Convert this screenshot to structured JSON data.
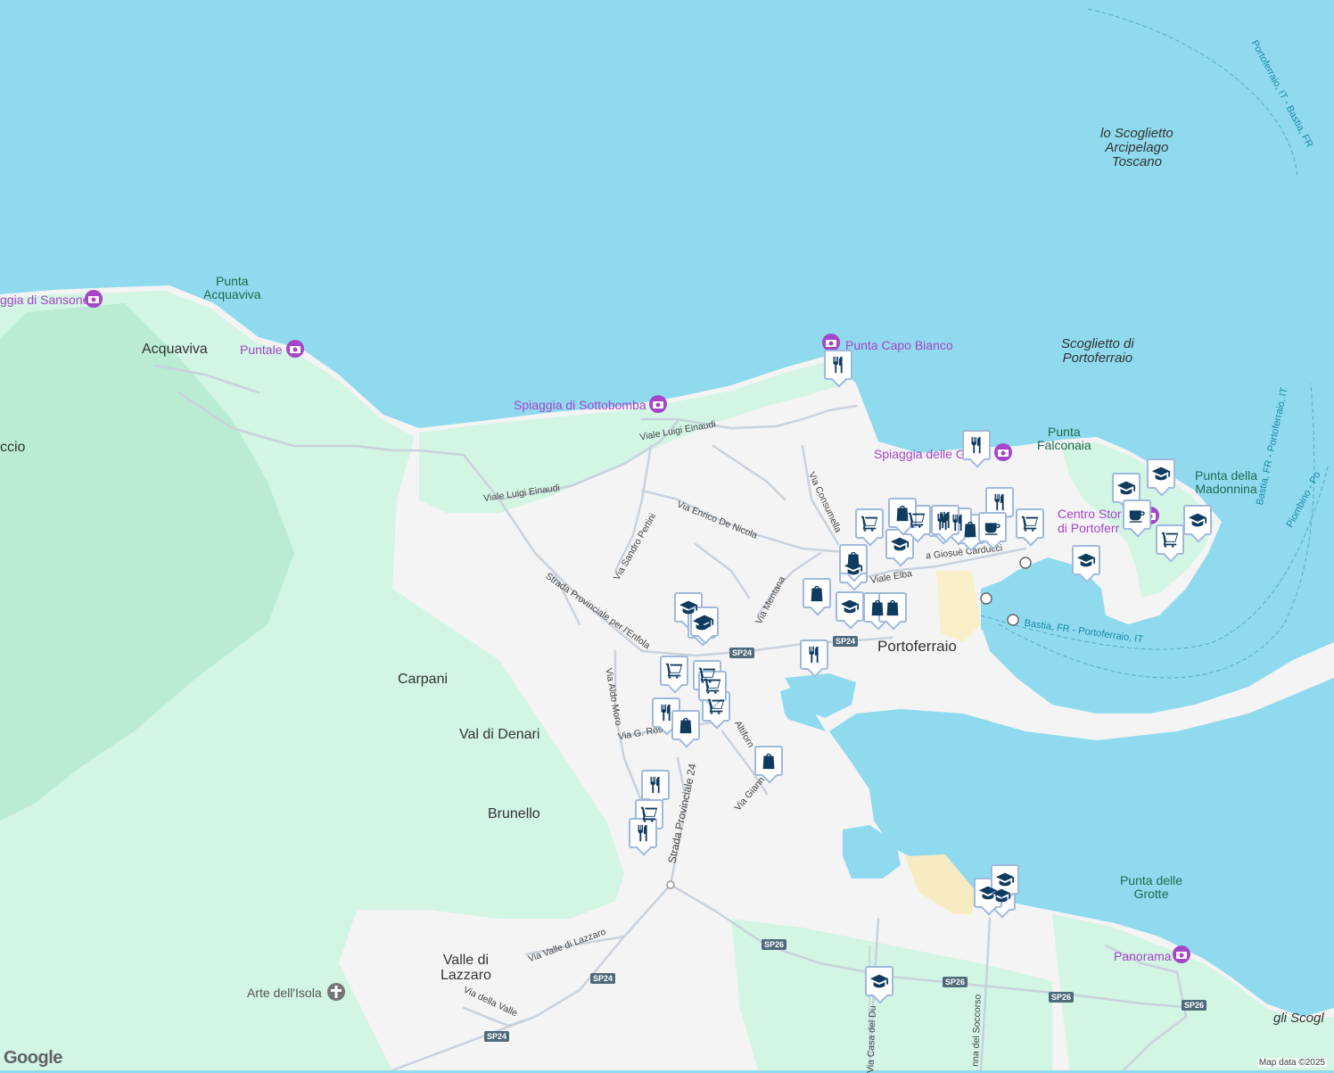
{
  "map": {
    "colors": {
      "water": "#8fdaee",
      "land": "#f4f4f4",
      "green": "#d2f5e4",
      "green_dark": "#b9ecd2",
      "poi": "#a546c8",
      "pin_icon": "#0f3b5f"
    },
    "places": [
      {
        "id": "acquaviva",
        "text": "Acquaviva"
      },
      {
        "id": "carpani",
        "text": "Carpani"
      },
      {
        "id": "val-di-denari",
        "text": "Val di Denari"
      },
      {
        "id": "brunello",
        "text": "Brunello"
      },
      {
        "id": "valle-di-lazzaro",
        "text": "Valle di\nLazzaro"
      },
      {
        "id": "portoferraio",
        "text": "Portoferraio"
      },
      {
        "id": "ccio",
        "text": "ccio"
      }
    ],
    "sea_labels": [
      {
        "id": "scoglietto-arcipelago",
        "text": "lo Scoglietto\nArcipelago\nToscano"
      },
      {
        "id": "scoglietto-portoferraio",
        "text": "Scoglietto di\nPortoferraio"
      },
      {
        "id": "gli-scogl",
        "text": "gli Scogl"
      }
    ],
    "green_labels": [
      {
        "id": "punta-acquaviva",
        "text": "Punta\nAcquaviva"
      },
      {
        "id": "punta-falconaia",
        "text": "Punta\nFalconaia"
      },
      {
        "id": "punta-della-madonnina",
        "text": "Punta della\nMadonnina"
      },
      {
        "id": "punta-delle-grotte",
        "text": "Punta delle\nGrotte"
      }
    ],
    "pois": [
      {
        "id": "spiaggia-sansone",
        "text": "ggia di Sansone"
      },
      {
        "id": "puntale",
        "text": "Puntale"
      },
      {
        "id": "punta-capo-bianco",
        "text": "Punta Capo Bianco"
      },
      {
        "id": "spiaggia-sottobomba",
        "text": "Spiaggia di Sottobomba"
      },
      {
        "id": "spiaggia-ghiaie",
        "text": "Spiaggia delle G"
      },
      {
        "id": "centro-storico",
        "text": "Centro Stor\ndi Portoferr"
      },
      {
        "id": "panorama",
        "text": "Panorama"
      },
      {
        "id": "arte-isola",
        "text": "Arte dell'Isola"
      }
    ],
    "roads": [
      {
        "id": "viale-einaudi-1",
        "text": "Viale Luigi Einaudi"
      },
      {
        "id": "viale-einaudi-2",
        "text": "Viale Luigi Einaudi"
      },
      {
        "id": "via-de-nicola",
        "text": "Via Enrico De Nicola"
      },
      {
        "id": "via-pertini",
        "text": "Via Sandro Pertini"
      },
      {
        "id": "via-consumella",
        "text": "Via Consumella"
      },
      {
        "id": "strada-enfola",
        "text": "Strada Provinciale per l'Enfola"
      },
      {
        "id": "via-mentana",
        "text": "Via Mentana"
      },
      {
        "id": "viale-elba",
        "text": "Viale Elba"
      },
      {
        "id": "via-carducci",
        "text": "a Giosuè Carducci"
      },
      {
        "id": "via-aldo-moro",
        "text": "Via Aldo Moro"
      },
      {
        "id": "via-g-ros",
        "text": "Via G. Ros"
      },
      {
        "id": "via-altiforni",
        "text": "Altiforn"
      },
      {
        "id": "via-giann",
        "text": "Via Giann"
      },
      {
        "id": "strada-24",
        "text": "Strada Provinciale 24"
      },
      {
        "id": "via-valle-lazzaro",
        "text": "Via Valle di Lazzaro"
      },
      {
        "id": "via-della-valle",
        "text": "Via della Valle"
      },
      {
        "id": "via-casa-due",
        "text": "Via Casa del Du"
      },
      {
        "id": "via-soccorso",
        "text": "nna del Soccorso"
      }
    ],
    "routes": [
      {
        "id": "ferry-bastia-1",
        "text": "Bastia, FR - Portoferraio, IT"
      },
      {
        "id": "ferry-bastia-2",
        "text": "Bastia, FR - Portoferraio, IT"
      },
      {
        "id": "ferry-portoferraio-bastia",
        "text": "Portoferraio, IT - Bastia, FR"
      },
      {
        "id": "ferry-piombino",
        "text": "Piombino - Po"
      }
    ],
    "shields": [
      "SP24",
      "SP24",
      "SP26",
      "SP26",
      "SP26",
      "SP26",
      "SP24",
      "SP24"
    ],
    "pins": [
      {
        "icon": "restaurant"
      },
      {
        "icon": "restaurant"
      },
      {
        "icon": "school"
      },
      {
        "icon": "school"
      },
      {
        "icon": "school"
      },
      {
        "icon": "school"
      },
      {
        "icon": "cafe"
      },
      {
        "icon": "cart"
      },
      {
        "icon": "cart"
      },
      {
        "icon": "school"
      },
      {
        "icon": "restaurant"
      },
      {
        "icon": "restaurant"
      },
      {
        "icon": "bag"
      },
      {
        "icon": "cafe"
      },
      {
        "icon": "cart"
      },
      {
        "icon": "cart"
      },
      {
        "icon": "restaurant"
      },
      {
        "icon": "bag"
      },
      {
        "icon": "school"
      },
      {
        "icon": "bag"
      },
      {
        "icon": "bag"
      },
      {
        "icon": "restaurant"
      },
      {
        "icon": "bag"
      },
      {
        "icon": "school"
      },
      {
        "icon": "bag"
      },
      {
        "icon": "school"
      },
      {
        "icon": "school"
      },
      {
        "icon": "school"
      },
      {
        "icon": "cart"
      },
      {
        "icon": "cart"
      },
      {
        "icon": "cart"
      },
      {
        "icon": "restaurant"
      },
      {
        "icon": "bag"
      },
      {
        "icon": "bag"
      },
      {
        "icon": "restaurant"
      },
      {
        "icon": "cart"
      },
      {
        "icon": "restaurant"
      },
      {
        "icon": "school"
      },
      {
        "icon": "school"
      },
      {
        "icon": "school"
      },
      {
        "icon": "restaurant"
      },
      {
        "icon": "cart"
      },
      {
        "icon": "school"
      }
    ],
    "attribution": "Map data ©2025",
    "logo": "Google"
  }
}
